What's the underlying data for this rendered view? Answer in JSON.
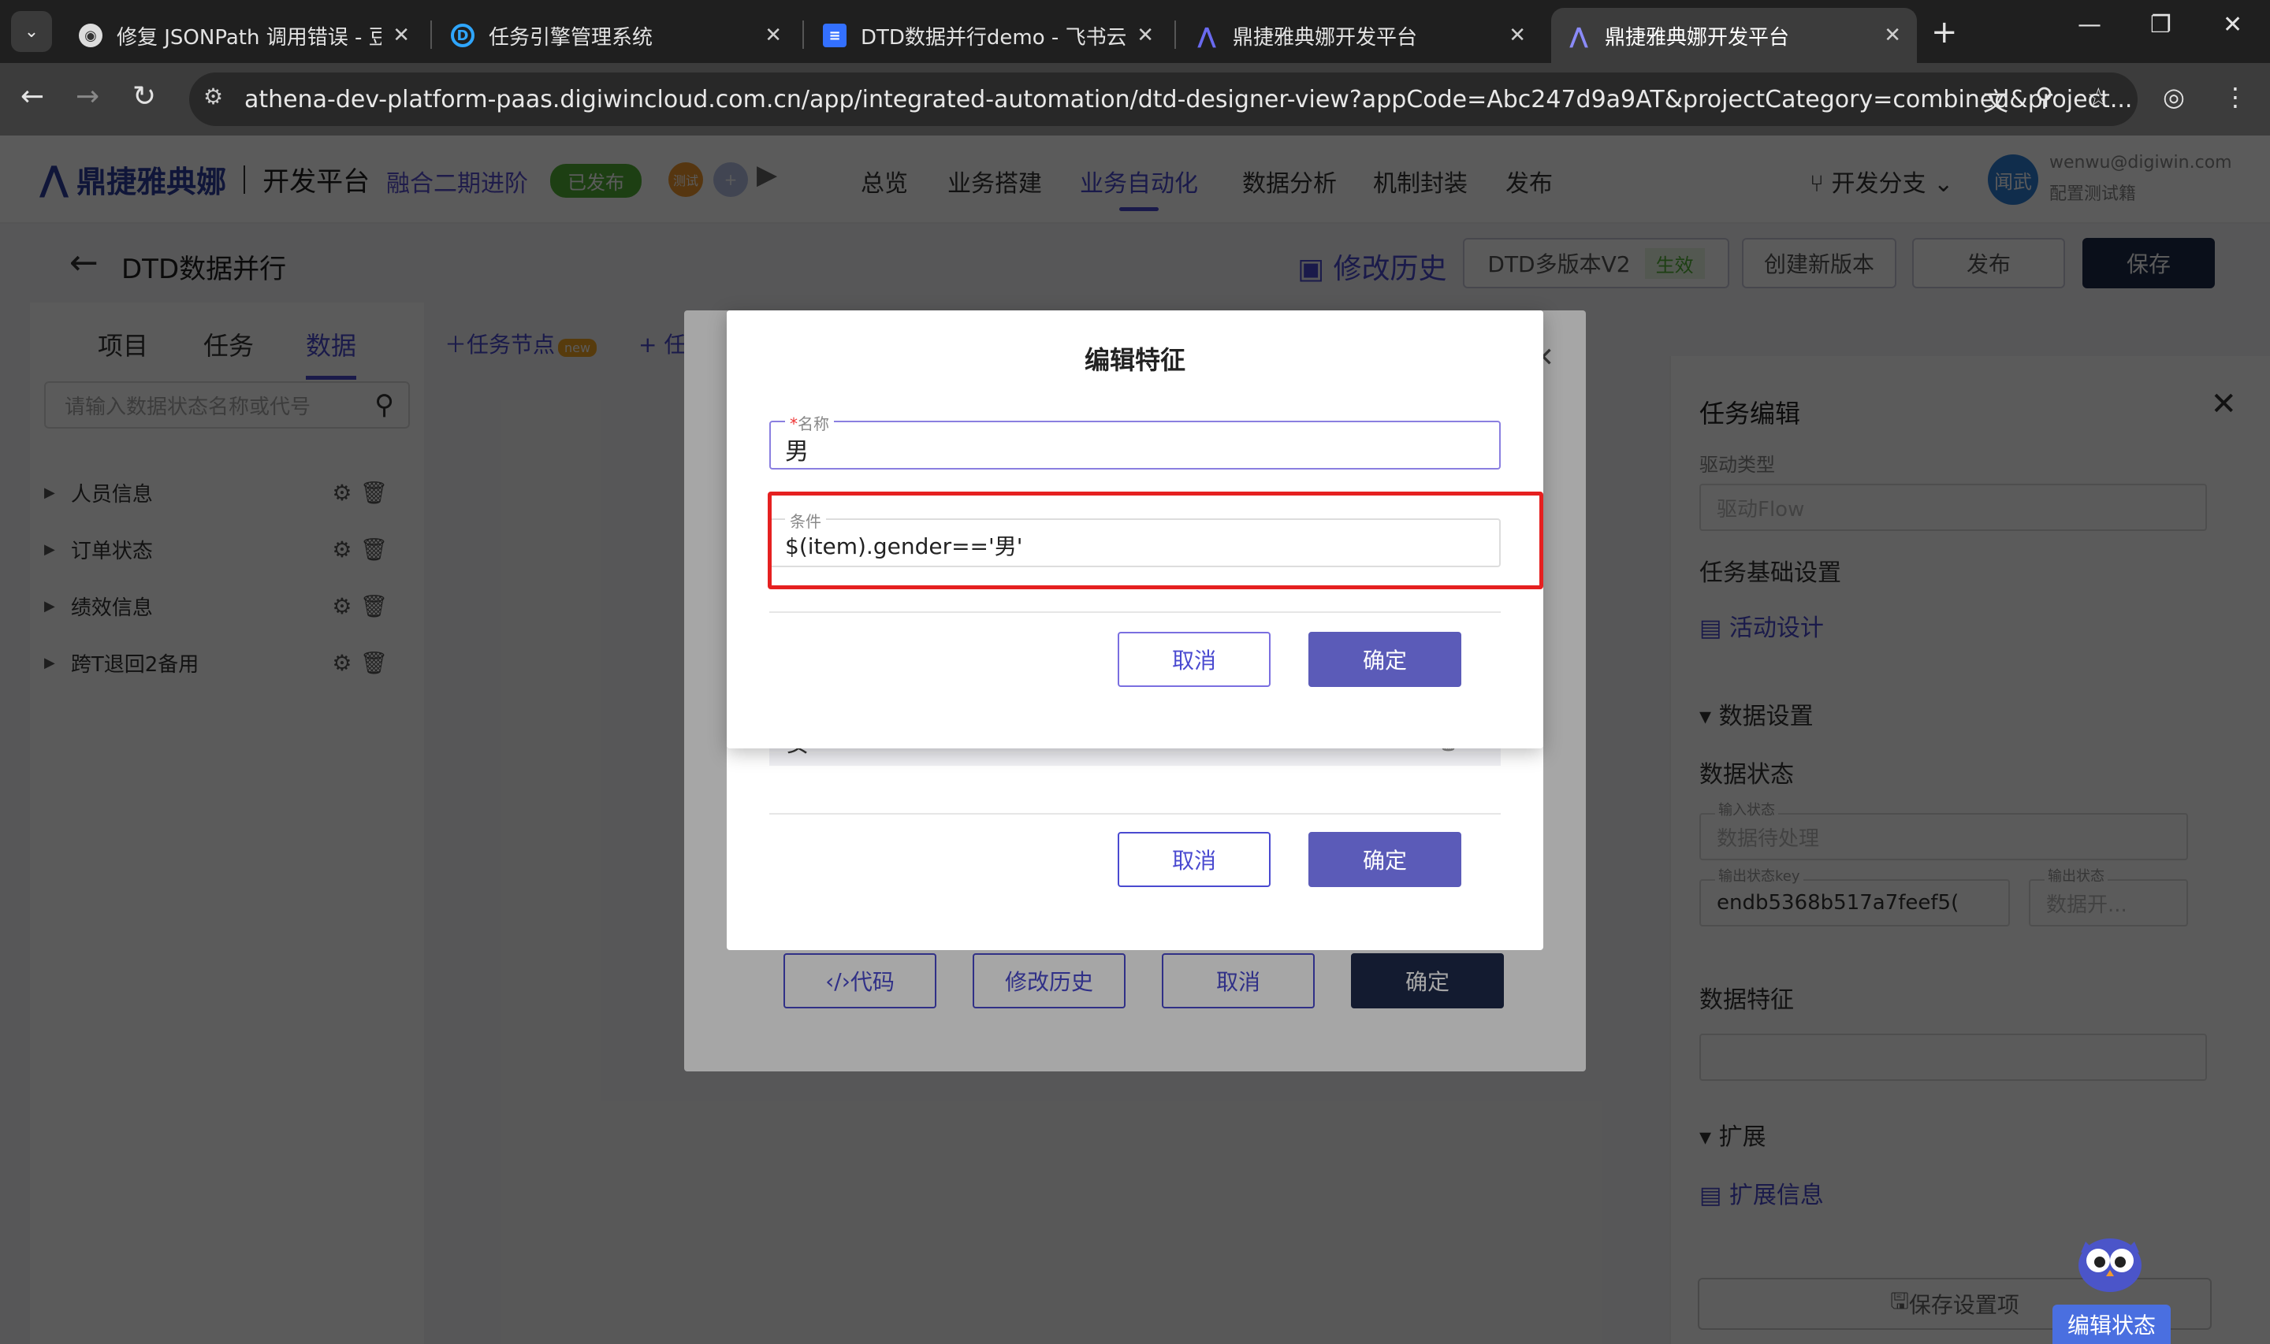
{
  "browser": {
    "tabs": [
      {
        "title": "修复 JSONPath 调用错误 - 豆包",
        "active": false
      },
      {
        "title": "任务引擎管理系统",
        "active": false
      },
      {
        "title": "DTD数据并行demo - 飞书云文档",
        "active": false
      },
      {
        "title": "鼎捷雅典娜开发平台",
        "active": false
      },
      {
        "title": "鼎捷雅典娜开发平台",
        "active": true
      }
    ],
    "url": "athena-dev-platform-paas.digiwincloud.com.cn/app/integrated-automation/dtd-designer-view?appCode=Abc247d9a9AT&projectCategory=combined&project..."
  },
  "header": {
    "logo": "鼎捷雅典娜",
    "platform": "开发平台",
    "app_name": "融合二期进阶",
    "status_badge": "已发布",
    "badge_a": "测试",
    "badge_b": "+",
    "menu": [
      "总览",
      "业务搭建",
      "业务自动化",
      "数据分析",
      "机制封装",
      "发布"
    ],
    "active_menu": "业务自动化",
    "branch": "开发分支",
    "avatar": "闻武",
    "user_email": "wenwu@digiwin.com",
    "user_role": "配置测试籍"
  },
  "subheader": {
    "title": "DTD数据并行",
    "history": "修改历史",
    "version": "DTD多版本V2",
    "version_status": "生效",
    "new_version": "创建新版本",
    "publish": "发布",
    "save": "保存"
  },
  "left_panel": {
    "tabs": [
      "项目",
      "任务",
      "数据"
    ],
    "active_tab": "数据",
    "search_placeholder": "请输入数据状态名称或代号",
    "items": [
      "人员信息",
      "订单状态",
      "绩效信息",
      "跨T退回2备用"
    ]
  },
  "canvas": {
    "toolbar": [
      "任务节点",
      "+ 任"
    ],
    "new_badge": "new"
  },
  "right_panel": {
    "title": "任务编辑",
    "drive_type_label": "驱动类型",
    "drive_type": "驱动Flow",
    "basic": "任务基础设置",
    "activity_design": "活动设计",
    "data_settings": "数据设置",
    "data_state": "数据状态",
    "input_state_label": "输入状态",
    "input_state": "数据待处理",
    "output_key_label": "输出状态key",
    "output_key": "endb5368b517a7feef5(",
    "output_state_label": "输出状态",
    "output_state": "数据开...",
    "data_feature": "数据特征",
    "extension": "扩展",
    "extension_info": "扩展信息",
    "save_settings": "保存设置项"
  },
  "dialog_outer": {
    "code": "代码",
    "history": "修改历史",
    "cancel": "取消",
    "confirm": "确定"
  },
  "dialog_mid": {
    "row_value": "女",
    "cancel": "取消",
    "confirm": "确定"
  },
  "dialog_edit": {
    "title": "编辑特征",
    "name_label": "名称",
    "name_required": "*",
    "name_value": "男",
    "condition_label": "条件",
    "condition_value": "$(item).gender=='男'",
    "cancel": "取消",
    "confirm": "确定"
  },
  "mascot": {
    "label": "编辑状态"
  },
  "colors": {
    "accent": "#4a4ad0",
    "primary_button": "#5b5bb8",
    "highlight": "#e52020",
    "published": "#52b338"
  }
}
